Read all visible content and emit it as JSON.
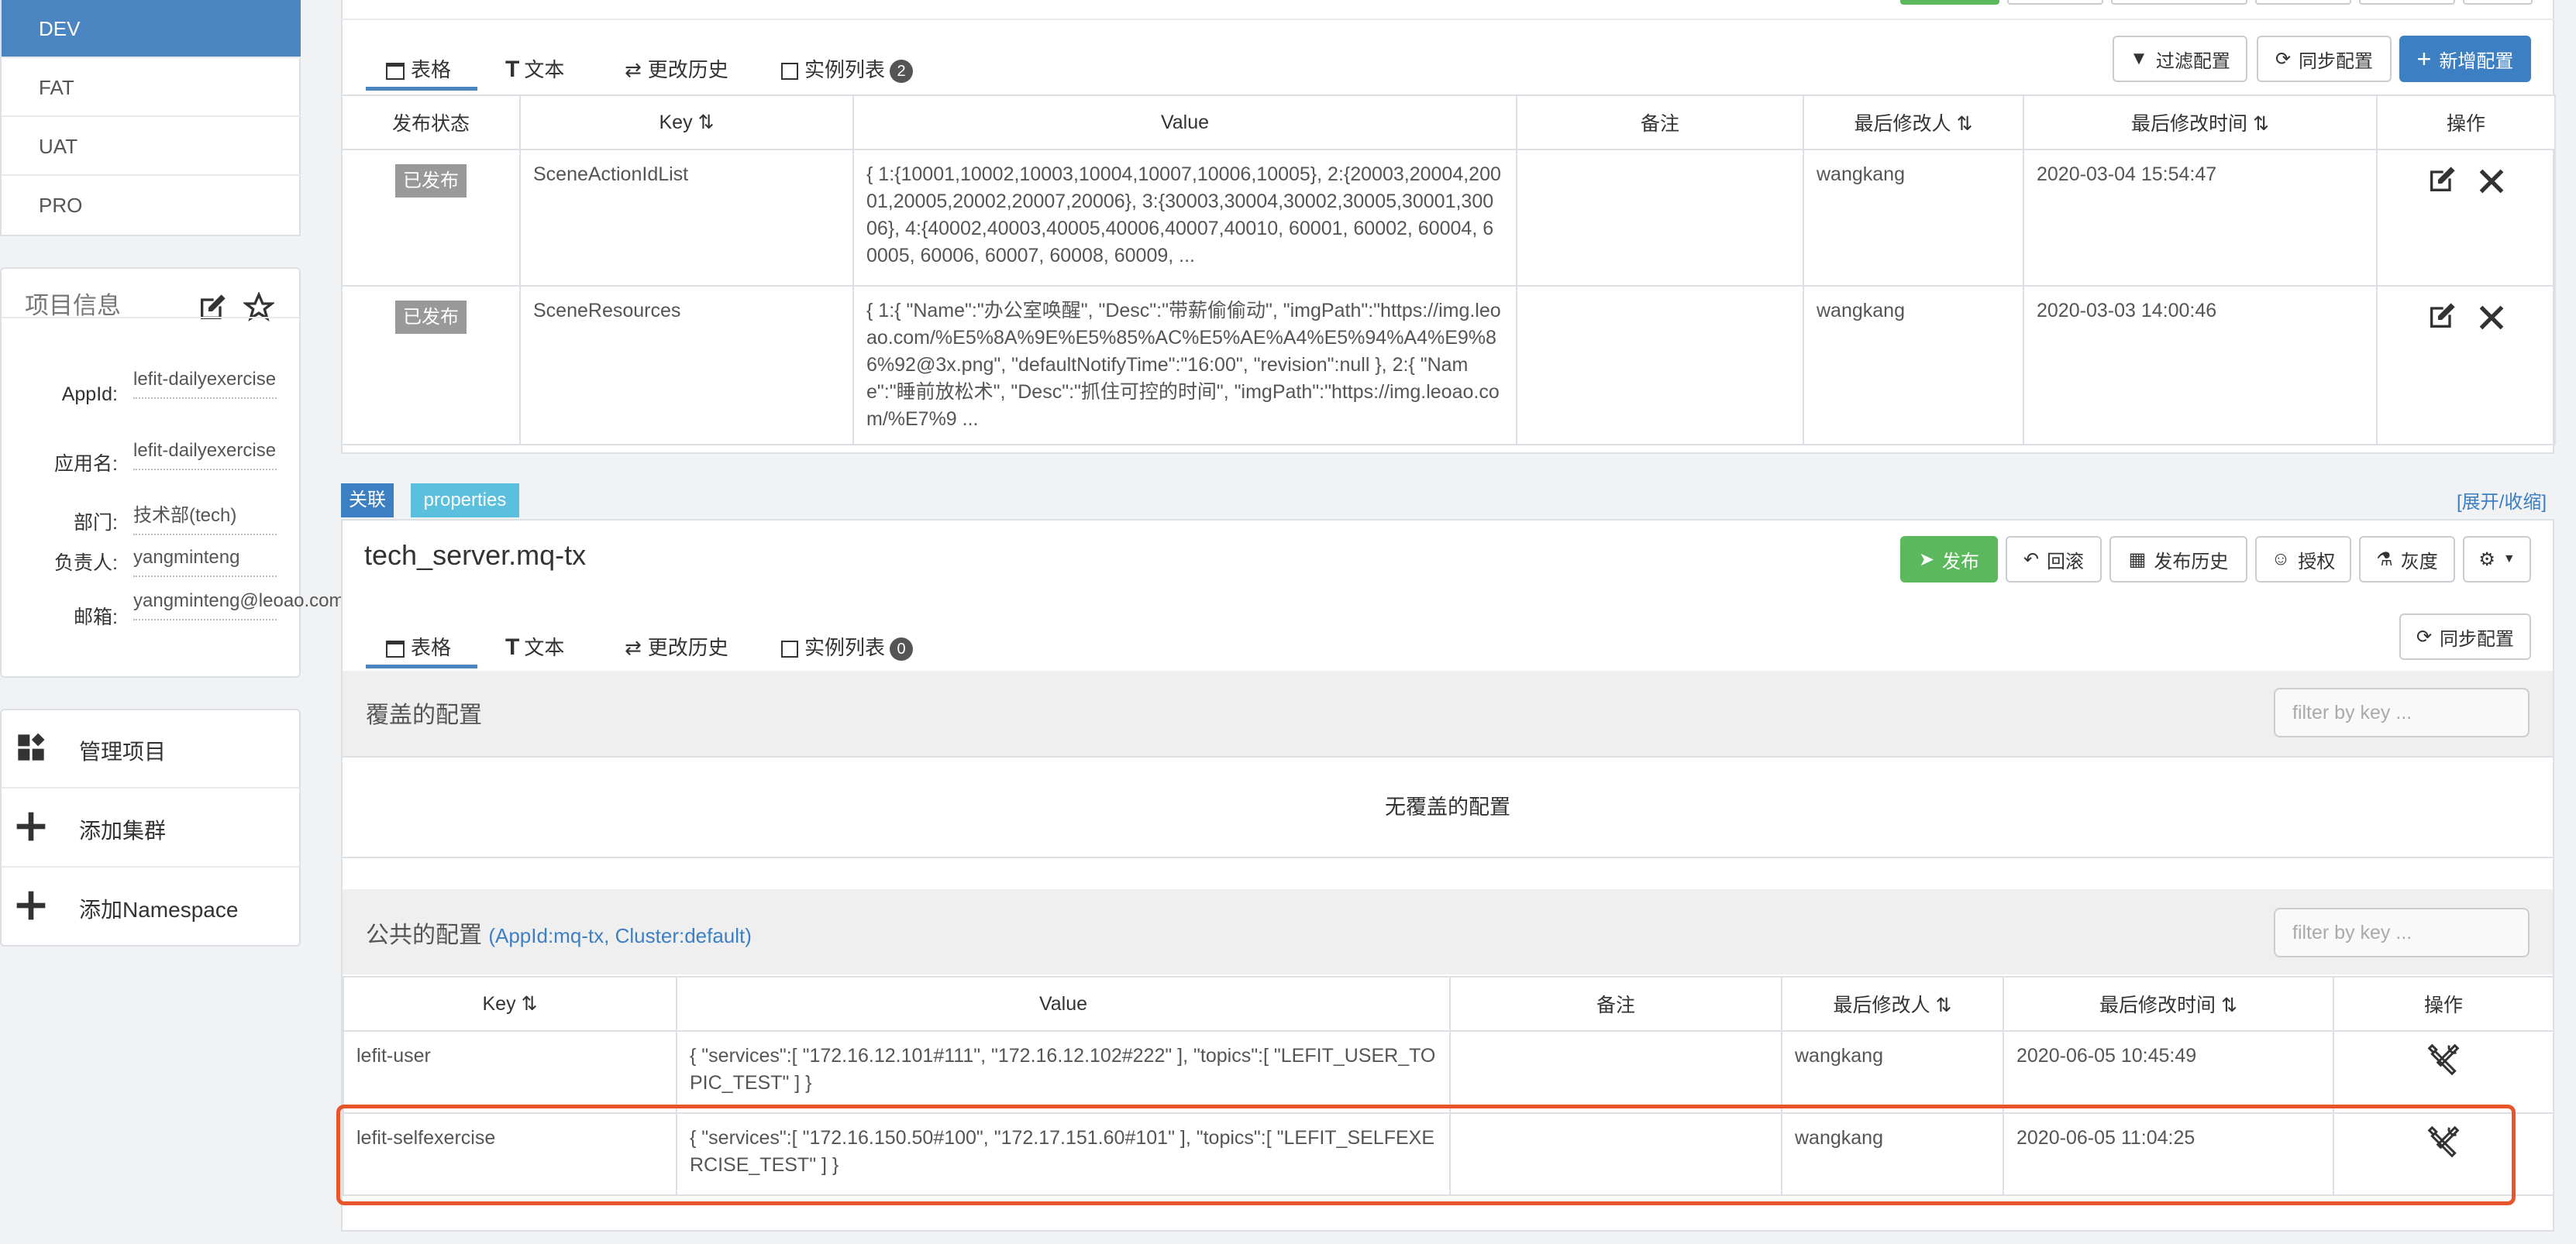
{
  "envs": [
    {
      "label": "DEV",
      "active": true
    },
    {
      "label": "FAT",
      "active": false
    },
    {
      "label": "UAT",
      "active": false
    },
    {
      "label": "PRO",
      "active": false
    }
  ],
  "project_info": {
    "title": "项目信息",
    "appid_label": "AppId:",
    "appid_value": "lefit-dailyexercise",
    "appname_label": "应用名:",
    "appname_value": "lefit-dailyexercise",
    "dept_label": "部门:",
    "dept_value": "技术部(tech)",
    "owner_label": "负责人:",
    "owner_value": "yangminteng",
    "email_label": "邮箱:",
    "email_value": "yangminteng@leoao.com"
  },
  "nav": {
    "manage": "管理项目",
    "add_cluster": "添加集群",
    "add_namespace": "添加Namespace"
  },
  "ns1": {
    "tabs": {
      "table": "表格",
      "text": "文本",
      "history": "更改历史",
      "instances": "实例列表",
      "instances_count": "2"
    },
    "buttons": {
      "filter": "过滤配置",
      "sync": "同步配置",
      "add": "新增配置"
    },
    "columns": {
      "status": "发布状态",
      "key": "Key",
      "value": "Value",
      "comment": "备注",
      "modifier": "最后修改人",
      "modified_time": "最后修改时间",
      "ops": "操作"
    },
    "rows": [
      {
        "status": "已发布",
        "key": "SceneActionIdList",
        "value": "{ 1:{10001,10002,10003,10004,10007,10006,10005}, 2:{20003,20004,20001,20005,20002,20007,20006}, 3:{30003,30004,30002,30005,30001,30006}, 4:{40002,40003,40005,40006,40007,40010, 60001, 60002, 60004, 60005, 60006, 60007, 60008, 60009, ...",
        "comment": "",
        "modifier": "wangkang",
        "time": "2020-03-04 15:54:47"
      },
      {
        "status": "已发布",
        "key": "SceneResources",
        "value": "{ 1:{ \"Name\":\"办公室唤醒\", \"Desc\":\"带薪偷偷动\", \"imgPath\":\"https://img.leoao.com/%E5%8A%9E%E5%85%AC%E5%AE%A4%E5%94%A4%E9%86%92@3x.png\", \"defaultNotifyTime\":\"16:00\", \"revision\":null }, 2:{ \"Name\":\"睡前放松术\", \"Desc\":\"抓住可控的时间\", \"imgPath\":\"https://img.leoao.com/%E7%9 ...",
        "comment": "",
        "modifier": "wangkang",
        "time": "2020-03-03 14:00:46"
      }
    ]
  },
  "ns2": {
    "tag_assoc": "关联",
    "tag_props": "properties",
    "expand": "[展开/收缩]",
    "title": "tech_server.mq-tx",
    "buttons": {
      "publish": "发布",
      "rollback": "回滚",
      "publish_history": "发布历史",
      "grant": "授权",
      "gray": "灰度",
      "sync": "同步配置"
    },
    "tabs": {
      "table": "表格",
      "text": "文本",
      "history": "更改历史",
      "instances": "实例列表",
      "instances_count": "0"
    },
    "override_title": "覆盖的配置",
    "filter_placeholder": "filter by key ...",
    "no_override": "无覆盖的配置",
    "public_title": "公共的配置",
    "public_sub": "(AppId:mq-tx, Cluster:default)",
    "columns": {
      "key": "Key",
      "value": "Value",
      "comment": "备注",
      "modifier": "最后修改人",
      "modified_time": "最后修改时间",
      "ops": "操作"
    },
    "rows": [
      {
        "key": "lefit-user",
        "value": "{ \"services\":[ \"172.16.12.101#111\", \"172.16.12.102#222\" ], \"topics\":[ \"LEFIT_USER_TOPIC_TEST\" ] }",
        "comment": "",
        "modifier": "wangkang",
        "time": "2020-06-05 10:45:49"
      },
      {
        "key": "lefit-selfexercise",
        "value": "{ \"services\":[ \"172.16.150.50#100\", \"172.17.151.60#101\" ], \"topics\":[ \"LEFIT_SELFEXERCISE_TEST\" ] }",
        "comment": "",
        "modifier": "wangkang",
        "time": "2020-06-05 11:04:25"
      }
    ]
  },
  "colors": {
    "accent": "#4b86c3",
    "success": "#5cb85c",
    "highlight": "#e8552b",
    "tag_props": "#5bc0de"
  }
}
